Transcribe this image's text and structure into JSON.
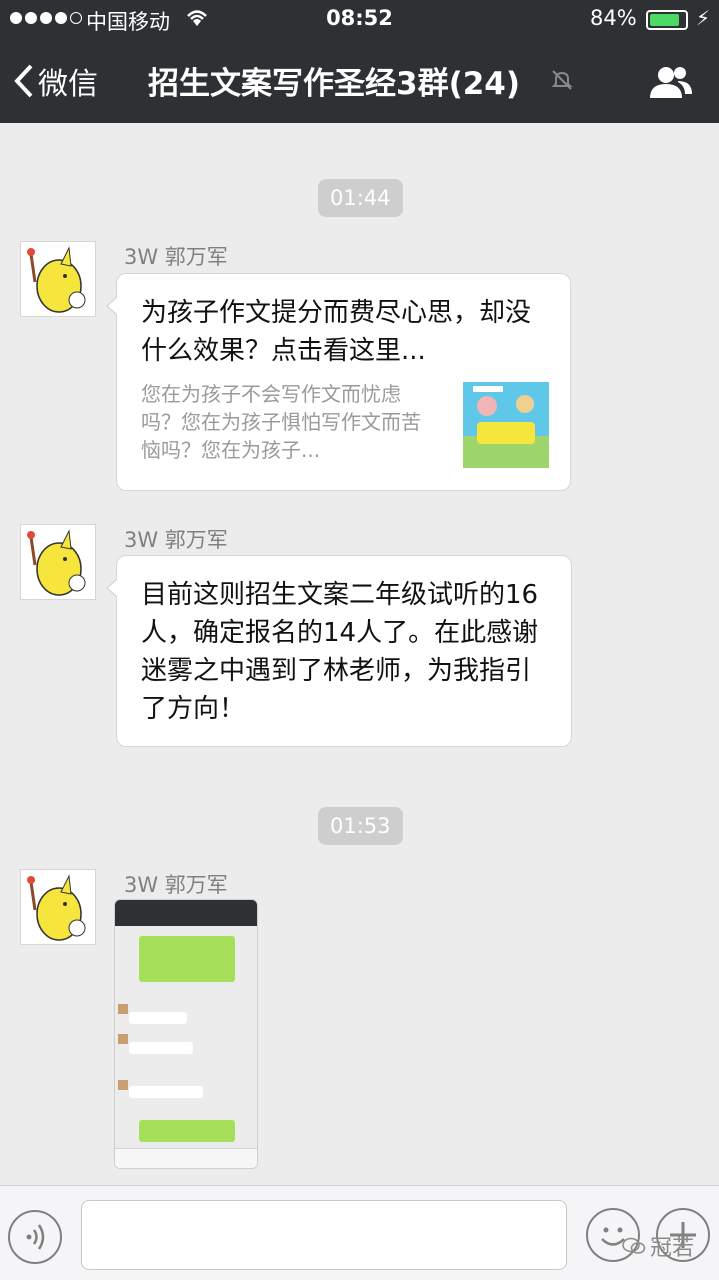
{
  "status_bar": {
    "carrier": "中国移动",
    "time": "08:52",
    "battery_text": "84%",
    "battery_level": 0.84
  },
  "nav": {
    "back_label": "微信",
    "title": "招生文案写作圣经3群(24)"
  },
  "messages": {
    "time_1": "01:44",
    "msg_1": {
      "sender": "3W 郭万军",
      "link_title": "为孩子作文提分而费尽心思，却没什么效果？点击看这里...",
      "link_desc": "您在为孩子不会写作文而忧虑吗？您在为孩子惧怕写作文而苦恼吗？您在为孩子..."
    },
    "msg_2": {
      "sender": "3W 郭万军",
      "text": "目前这则招生文案二年级试听的16人，确定报名的14人了。在此感谢迷雾之中遇到了林老师，为我指引了方向！"
    },
    "time_2": "01:53",
    "msg_3": {
      "sender": "3W 郭万军",
      "image_label": "screenshot"
    }
  },
  "input_bar": {
    "placeholder": "",
    "watermark": "冠若"
  }
}
